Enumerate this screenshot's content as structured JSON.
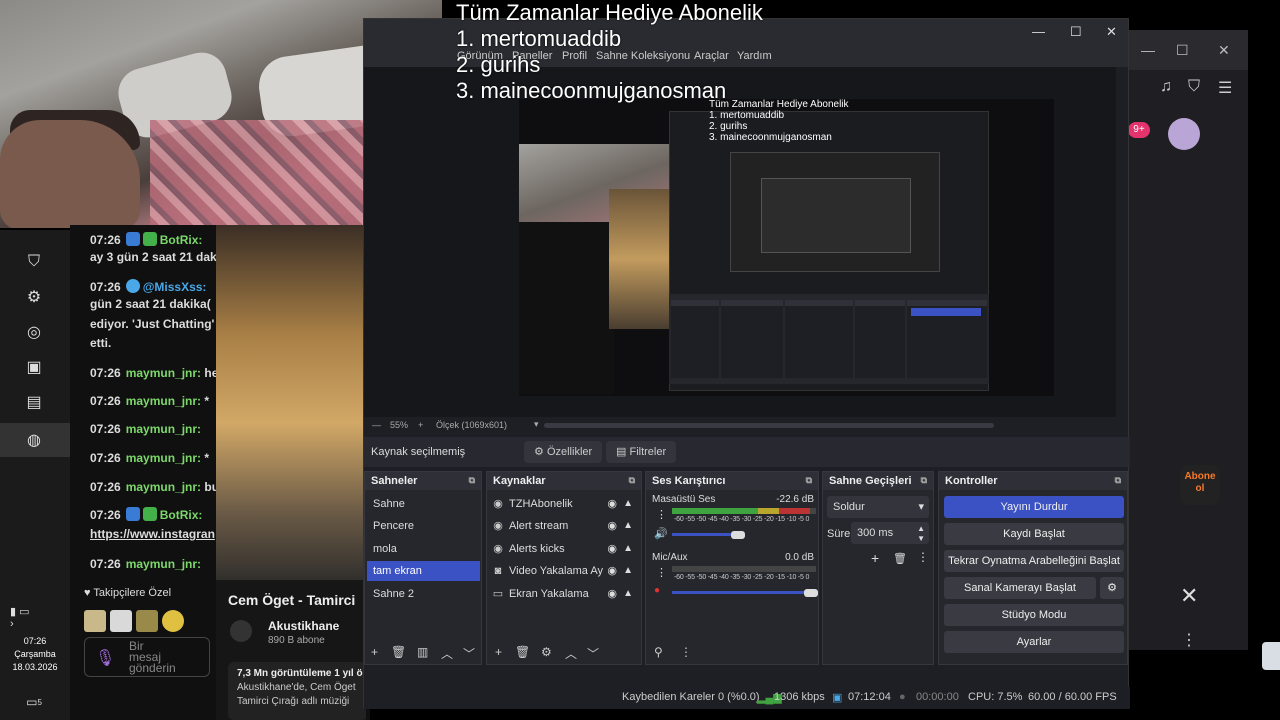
{
  "overlay": {
    "title": "Tüm Zamanlar Hediye  Abonelik",
    "line1": "1. mertomuaddib",
    "line2": "2. gurihs",
    "line3": "3. mainecoonmujganosman"
  },
  "obs": {
    "menu": [
      "Görünüm",
      "Paneller",
      "Profil",
      "Sahne Koleksiyonu",
      "Araçlar",
      "Yardım"
    ],
    "zoom": "55%",
    "scale": "Ölçek (1069x601)",
    "no_source": "Kaynak seçilmemiş",
    "properties": "Özellikler",
    "filters": "Filtreler",
    "scenes_title": "Sahneler",
    "scenes": [
      "Sahne",
      "Pencere",
      "mola",
      "tam ekran",
      "Sahne 2"
    ],
    "sources_title": "Kaynaklar",
    "sources": [
      {
        "icon": "globe-icon",
        "glyph": "◉",
        "label": "TZHAbonelik"
      },
      {
        "icon": "globe-icon",
        "glyph": "◉",
        "label": "Alert stream"
      },
      {
        "icon": "globe-icon",
        "glyph": "◉",
        "label": "Alerts kicks"
      },
      {
        "icon": "camera-icon",
        "glyph": "◙",
        "label": "Video Yakalama Ay"
      },
      {
        "icon": "monitor-icon",
        "glyph": "▭",
        "label": "Ekran Yakalama"
      }
    ],
    "mixer_title": "Ses Karıştırıcı",
    "mixer": [
      {
        "name": "Masaüstü Ses",
        "db": "-22.6 dB",
        "level": 0.62
      },
      {
        "name": "Mic/Aux",
        "db": "0.0 dB",
        "level": 0.0
      }
    ],
    "meter_scale": "-60 -55 -50 -45 -40 -35 -30 -25 -20 -15 -10 -5 0",
    "transitions_title": "Sahne Geçişleri",
    "transition": "Soldur",
    "duration_label": "Süre",
    "duration": "300 ms",
    "controls_title": "Kontroller",
    "controls": [
      "Yayını Durdur",
      "Kaydı Başlat",
      "Tekrar Oynatma Arabelleğini Başlat",
      "Sanal Kamerayı Başlat",
      "Stüdyo Modu",
      "Ayarlar"
    ],
    "status": {
      "dropped": "Kaybedilen Kareler 0 (%0.0)",
      "bitrate": "1306 kbps",
      "stream_time": "07:12:04",
      "rec_time": "00:00:00",
      "cpu": "CPU: 7.5%",
      "fps": "60.00 / 60.00 FPS"
    }
  },
  "chat": {
    "lines": [
      {
        "time": "07:26",
        "user": "BotRix:",
        "text": "",
        "color": "#7cd86b"
      },
      {
        "time": "",
        "user": "",
        "text": "ay 3 gün 2 saat 21 daki",
        "color": ""
      },
      {
        "time": "07:26",
        "user": "@MissXss:",
        "text": "",
        "color": "#4aa8e8"
      },
      {
        "time": "",
        "user": "",
        "text": "gün 2 saat 21 dakika(",
        "color": ""
      },
      {
        "time": "",
        "user": "",
        "text": "ediyor. 'Just Chatting'",
        "color": ""
      },
      {
        "time": "",
        "user": "",
        "text": "etti.",
        "color": ""
      },
      {
        "time": "07:26",
        "user": "maymun_jnr:",
        "text": "he",
        "color": "#7cd86b"
      },
      {
        "time": "07:26",
        "user": "maymun_jnr:",
        "text": "*",
        "color": "#7cd86b"
      },
      {
        "time": "07:26",
        "user": "maymun_jnr:",
        "text": "",
        "color": "#7cd86b"
      },
      {
        "time": "07:26",
        "user": "maymun_jnr:",
        "text": "*",
        "color": "#7cd86b"
      },
      {
        "time": "07:26",
        "user": "maymun_jnr:",
        "text": "bu",
        "color": "#7cd86b"
      },
      {
        "time": "07:26",
        "user": "BotRix:",
        "text": "",
        "color": "#7cd86b"
      },
      {
        "time": "",
        "user": "",
        "text": "https://www.instagran",
        "color": ""
      },
      {
        "time": "07:26",
        "user": "maymun_jnr:",
        "text": "",
        "color": "#7cd86b"
      }
    ],
    "followers_only": "Takipçilere Özel",
    "send_placeholder": "Bir mesaj gönderin"
  },
  "video": {
    "title": "Cem Öget - Tamirci",
    "channel": "Akustikhane",
    "subs": "890 B abone",
    "desc1": "7,3 Mn görüntüleme  1 yıl ö",
    "desc2": "Akustikhane'de, Cem Öget",
    "desc3": "Tamirci Çırağı adlı müziği"
  },
  "taskbar": {
    "time": "07:26",
    "day": "Çarşamba",
    "date": "18.03.2026",
    "badge": "5"
  },
  "side": {
    "abone": "Abone ol",
    "notif": "9+"
  }
}
